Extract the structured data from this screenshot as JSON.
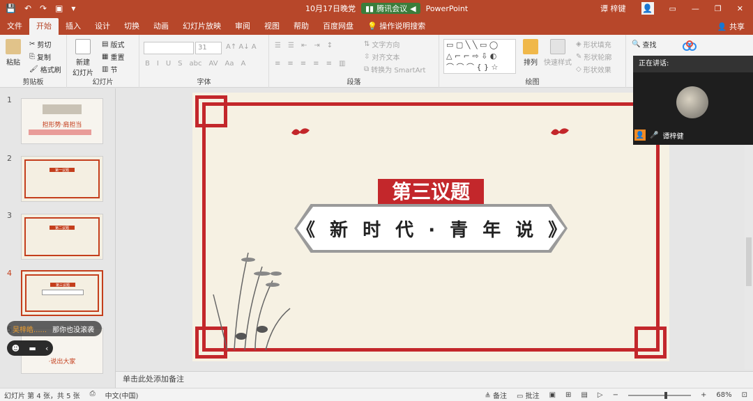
{
  "titlebar": {
    "doc_title": "10月17日晚党",
    "meeting_label": "腾讯会议",
    "app_name": "PowerPoint",
    "user_name": "谭 梓键"
  },
  "tabs": [
    "文件",
    "开始",
    "插入",
    "设计",
    "切换",
    "动画",
    "幻灯片放映",
    "审阅",
    "视图",
    "帮助",
    "百度网盘",
    "操作说明搜索"
  ],
  "share_label": "共享",
  "ribbon": {
    "clipboard": {
      "label": "剪贴板",
      "paste": "粘贴",
      "cut": "剪切",
      "copy": "复制",
      "format_painter": "格式刷"
    },
    "slides": {
      "label": "幻灯片",
      "new_slide": "新建\n幻灯片",
      "layout": "版式",
      "reset": "重置",
      "section": "节"
    },
    "font": {
      "label": "字体",
      "size": "31"
    },
    "paragraph": {
      "label": "段落",
      "text_direction": "文字方向",
      "align_text": "对齐文本",
      "smartart": "转换为 SmartArt"
    },
    "drawing": {
      "label": "绘图",
      "arrange": "排列",
      "quick_styles": "快速样式",
      "shape_fill": "形状填充",
      "shape_outline": "形状轮廓",
      "shape_effects": "形状效果"
    },
    "editing": {
      "find": "查找"
    }
  },
  "thumbnails": [
    {
      "num": "1",
      "text": "担形势·肩担当"
    },
    {
      "num": "2",
      "text": "第一议题"
    },
    {
      "num": "3",
      "text": "第二议题"
    },
    {
      "num": "4",
      "text": "第三议题"
    },
    {
      "num": "5",
      "text": "·说出大家"
    }
  ],
  "chat": {
    "sender": "吴梓皓......",
    "message": "那你也没滚袭"
  },
  "slide": {
    "title": "第三议题",
    "subtitle": "《 新 时 代 · 青 年 说 》"
  },
  "notes_placeholder": "单击此处添加备注",
  "status": {
    "slide_info": "幻灯片 第 4 张，共 5 张",
    "language": "中文(中国)",
    "notes": "备注",
    "comments": "批注",
    "zoom": "68%"
  },
  "meeting": {
    "speaking_label": "正在讲话:",
    "participant": "谭梓健"
  }
}
